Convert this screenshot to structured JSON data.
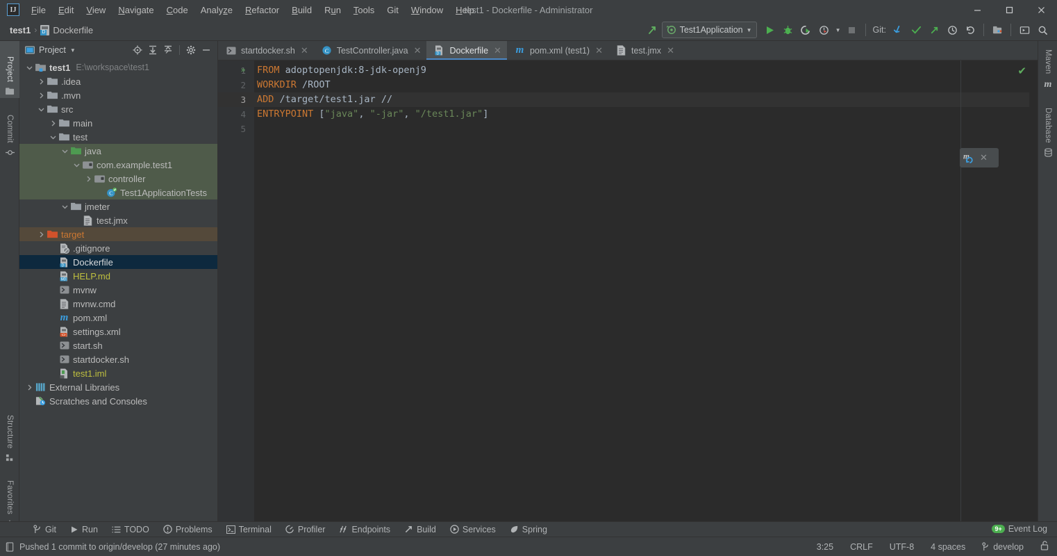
{
  "window": {
    "title": "test1 - Dockerfile - Administrator",
    "logo": "IJ",
    "minimize_label": "–",
    "maximize_label": "☐",
    "close_label": "✕"
  },
  "menubar": {
    "items": [
      {
        "label": "File",
        "mnemonic": "F"
      },
      {
        "label": "Edit",
        "mnemonic": "E"
      },
      {
        "label": "View",
        "mnemonic": "V"
      },
      {
        "label": "Navigate",
        "mnemonic": "N"
      },
      {
        "label": "Code",
        "mnemonic": "C"
      },
      {
        "label": "Analyze",
        "mnemonic": "z"
      },
      {
        "label": "Refactor",
        "mnemonic": "R"
      },
      {
        "label": "Build",
        "mnemonic": "B"
      },
      {
        "label": "Run",
        "mnemonic": "u"
      },
      {
        "label": "Tools",
        "mnemonic": "T"
      },
      {
        "label": "Git",
        "mnemonic": ""
      },
      {
        "label": "Window",
        "mnemonic": "W"
      },
      {
        "label": "Help",
        "mnemonic": "H"
      }
    ]
  },
  "navbar": {
    "breadcrumb": [
      "test1",
      "Dockerfile"
    ],
    "separator": "›",
    "run_config": "Test1Application",
    "run_config_caret": "▼",
    "git_label": "Git:",
    "buttons": {
      "build_hammer": "build-icon",
      "run": "run-icon",
      "debug": "debug-icon",
      "run_coverage": "coverage-icon",
      "profile": "profile-icon",
      "stop": "stop-icon",
      "git_update": "git-update-icon",
      "git_commit": "git-commit-icon",
      "git_push": "git-push-icon",
      "git_history": "history-icon",
      "git_rollback": "rollback-icon",
      "project_structure": "project-structure-icon",
      "run_anything": "run-anything-icon",
      "search_everywhere": "search-icon"
    }
  },
  "left_tool_strip": {
    "items": [
      {
        "label": "Project",
        "icon": "project-icon",
        "active": true
      },
      {
        "label": "Commit",
        "icon": "commit-icon",
        "active": false
      },
      {
        "label": "Structure",
        "icon": "structure-icon",
        "active": false
      },
      {
        "label": "Favorites",
        "icon": "star-icon",
        "active": false
      }
    ]
  },
  "right_tool_strip": {
    "items": [
      {
        "label": "Maven",
        "icon": "maven-icon"
      },
      {
        "label": "Database",
        "icon": "database-icon"
      }
    ]
  },
  "project_panel": {
    "title": "Project",
    "caret": "▼",
    "header_icons": [
      {
        "name": "select-opened-file-icon",
        "glyph": "⌖"
      },
      {
        "name": "expand-all-icon",
        "glyph": "↧"
      },
      {
        "name": "collapse-all-icon",
        "glyph": "↥"
      },
      {
        "name": "settings-gear-icon",
        "glyph": "⚙"
      },
      {
        "name": "hide-panel-icon",
        "glyph": "—"
      }
    ],
    "tree": [
      {
        "label": "test1",
        "suffix": "E:\\workspace\\test1",
        "indent": 0,
        "arrow": "down",
        "icon": "module-icon",
        "style": "bold"
      },
      {
        "label": ".idea",
        "indent": 1,
        "arrow": "right",
        "icon": "folder-icon"
      },
      {
        "label": ".mvn",
        "indent": 1,
        "arrow": "right",
        "icon": "folder-icon"
      },
      {
        "label": "src",
        "indent": 1,
        "arrow": "down",
        "icon": "folder-icon"
      },
      {
        "label": "main",
        "indent": 2,
        "arrow": "right",
        "icon": "folder-icon"
      },
      {
        "label": "test",
        "indent": 2,
        "arrow": "down",
        "icon": "folder-icon"
      },
      {
        "label": "java",
        "indent": 3,
        "arrow": "down",
        "icon": "folder-green-icon",
        "highlight": "green"
      },
      {
        "label": "com.example.test1",
        "indent": 4,
        "arrow": "down",
        "icon": "package-icon",
        "highlight": "green"
      },
      {
        "label": "controller",
        "indent": 5,
        "arrow": "right",
        "icon": "package-icon",
        "highlight": "green"
      },
      {
        "label": "Test1ApplicationTests",
        "indent": 6,
        "arrow": "none",
        "icon": "test-class-icon",
        "highlight": "green"
      },
      {
        "label": "jmeter",
        "indent": 3,
        "arrow": "down",
        "icon": "folder-icon"
      },
      {
        "label": "test.jmx",
        "indent": 4,
        "arrow": "none",
        "icon": "file-icon"
      },
      {
        "label": "target",
        "indent": 1,
        "arrow": "right",
        "icon": "folder-orange-icon",
        "style": "orange",
        "highlight": "brown"
      },
      {
        "label": ".gitignore",
        "indent": 2,
        "arrow": "none",
        "icon": "gitignore-icon"
      },
      {
        "label": "Dockerfile",
        "indent": 2,
        "arrow": "none",
        "icon": "dockerfile-icon",
        "selected": true,
        "style": "white"
      },
      {
        "label": "HELP.md",
        "indent": 2,
        "arrow": "none",
        "icon": "markdown-icon",
        "style": "yellow"
      },
      {
        "label": "mvnw",
        "indent": 2,
        "arrow": "none",
        "icon": "shell-icon"
      },
      {
        "label": "mvnw.cmd",
        "indent": 2,
        "arrow": "none",
        "icon": "file-icon"
      },
      {
        "label": "pom.xml",
        "indent": 2,
        "arrow": "none",
        "icon": "maven-pom-icon"
      },
      {
        "label": "settings.xml",
        "indent": 2,
        "arrow": "none",
        "icon": "xml-icon"
      },
      {
        "label": "start.sh",
        "indent": 2,
        "arrow": "none",
        "icon": "shell-icon"
      },
      {
        "label": "startdocker.sh",
        "indent": 2,
        "arrow": "none",
        "icon": "shell-icon"
      },
      {
        "label": "test1.iml",
        "indent": 2,
        "arrow": "none",
        "icon": "iml-icon",
        "style": "yellow"
      },
      {
        "label": "External Libraries",
        "indent": 0,
        "arrow": "right",
        "icon": "libraries-icon"
      },
      {
        "label": "Scratches and Consoles",
        "indent": 0,
        "arrow": "none",
        "icon": "scratches-icon"
      }
    ]
  },
  "editor": {
    "tabs": [
      {
        "label": "startdocker.sh",
        "icon": "shell-icon",
        "active": false,
        "close": "✕"
      },
      {
        "label": "TestController.java",
        "icon": "class-icon",
        "active": false,
        "close": "✕"
      },
      {
        "label": "Dockerfile",
        "icon": "dockerfile-icon",
        "active": true,
        "close": "✕"
      },
      {
        "label": "pom.xml (test1)",
        "icon": "maven-pom-icon",
        "active": false,
        "close": "✕"
      },
      {
        "label": "test.jmx",
        "icon": "file-icon",
        "active": false,
        "close": "✕"
      }
    ],
    "line_numbers": [
      "1",
      "2",
      "3",
      "4",
      "5"
    ],
    "current_line": 3,
    "run_gutter_glyph": "»",
    "inspection_status": "✔",
    "lines": [
      {
        "n": 1,
        "tokens": [
          {
            "t": "FROM",
            "c": "kw"
          },
          {
            "t": " adoptopenjdk:8-jdk-openj9",
            "c": "plain"
          }
        ]
      },
      {
        "n": 2,
        "tokens": [
          {
            "t": "WORKDIR",
            "c": "kw"
          },
          {
            "t": " /ROOT",
            "c": "plain"
          }
        ]
      },
      {
        "n": 3,
        "tokens": [
          {
            "t": "ADD",
            "c": "kw"
          },
          {
            "t": " /target/test1.jar ",
            "c": "plain"
          },
          {
            "t": "//",
            "c": "plain"
          }
        ]
      },
      {
        "n": 4,
        "tokens": [
          {
            "t": "ENTRYPOINT",
            "c": "kw"
          },
          {
            "t": " [",
            "c": "plain"
          },
          {
            "t": "\"java\"",
            "c": "str"
          },
          {
            "t": ", ",
            "c": "plain"
          },
          {
            "t": "\"-jar\"",
            "c": "str"
          },
          {
            "t": ", ",
            "c": "plain"
          },
          {
            "t": "\"/test1.jar\"",
            "c": "str"
          },
          {
            "t": "]",
            "c": "plain"
          }
        ]
      },
      {
        "n": 5,
        "tokens": []
      }
    ],
    "maven_popup": {
      "icon": "maven-reload-icon",
      "close": "✕"
    }
  },
  "bottom_bar": {
    "items": [
      {
        "label": "Git",
        "icon": "git-branch-icon"
      },
      {
        "label": "Run",
        "icon": "run-icon"
      },
      {
        "label": "TODO",
        "icon": "todo-icon"
      },
      {
        "label": "Problems",
        "icon": "problems-icon"
      },
      {
        "label": "Terminal",
        "icon": "terminal-icon"
      },
      {
        "label": "Profiler",
        "icon": "profiler-icon"
      },
      {
        "label": "Endpoints",
        "icon": "endpoints-icon"
      },
      {
        "label": "Build",
        "icon": "build-hammer-icon"
      },
      {
        "label": "Services",
        "icon": "services-icon"
      },
      {
        "label": "Spring",
        "icon": "spring-leaf-icon"
      }
    ],
    "event_log": {
      "label": "Event Log",
      "badge": "9+"
    }
  },
  "statusbar": {
    "message": "Pushed 1 commit to origin/develop (27 minutes ago)",
    "message_icon": "notification-icon",
    "caret_position": "3:25",
    "line_separator": "CRLF",
    "encoding": "UTF-8",
    "indent": "4 spaces",
    "branch": "develop",
    "branch_icon": "git-branch-icon",
    "lock_icon": "lock-icon"
  },
  "colors": {
    "accent_blue": "#4a88c7",
    "selection_blue": "#0d293e",
    "keyword_orange": "#cc7832",
    "string_green": "#6a8759",
    "ui_bg": "#3c3f41",
    "editor_bg": "#2b2b2b",
    "desktop_teal": "#5c8c90"
  }
}
